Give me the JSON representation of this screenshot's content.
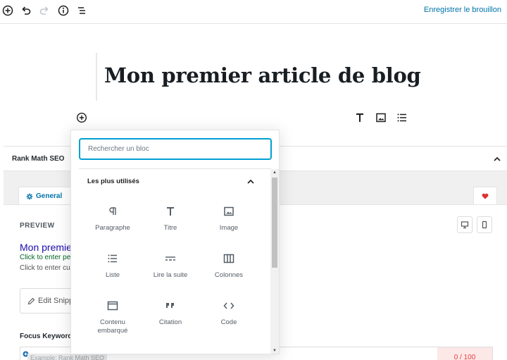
{
  "toolbar": {
    "save_draft": "Enregistrer le brouillon",
    "icons": [
      "add-block-icon",
      "undo-icon",
      "redo-icon",
      "info-icon",
      "outline-icon"
    ]
  },
  "post": {
    "title": "Mon premier article de blog"
  },
  "rank_math": {
    "panel_title": "Rank Math SEO",
    "tab_general": "General",
    "preview_label": "PREVIEW",
    "snippet_title": "Mon premier",
    "snippet_url": "Click to enter pe",
    "snippet_desc": "Click to enter cus",
    "edit_snippet": "Edit Snipp",
    "focus_keyword_label": "Focus Keyword",
    "keyword_placeholder": "Example: Rank Math SEO",
    "score": "0 / 100"
  },
  "inserter": {
    "search_placeholder": "Rechercher un bloc",
    "category": "Les plus utilisés",
    "blocks": [
      {
        "label": "Paragraphe",
        "icon": "paragraph-icon"
      },
      {
        "label": "Titre",
        "icon": "heading-icon"
      },
      {
        "label": "Image",
        "icon": "image-icon"
      },
      {
        "label": "Liste",
        "icon": "list-icon"
      },
      {
        "label": "Lire la suite",
        "icon": "more-icon"
      },
      {
        "label": "Colonnes",
        "icon": "columns-icon"
      },
      {
        "label": "Contenu embarqué",
        "icon": "embed-icon"
      },
      {
        "label": "Citation",
        "icon": "quote-icon"
      },
      {
        "label": "Code",
        "icon": "code-icon"
      }
    ]
  },
  "colors": {
    "accent": "#0073aa",
    "focus": "#00a0d2",
    "heart": "#dc3232",
    "score_bg": "#fde8e8"
  }
}
